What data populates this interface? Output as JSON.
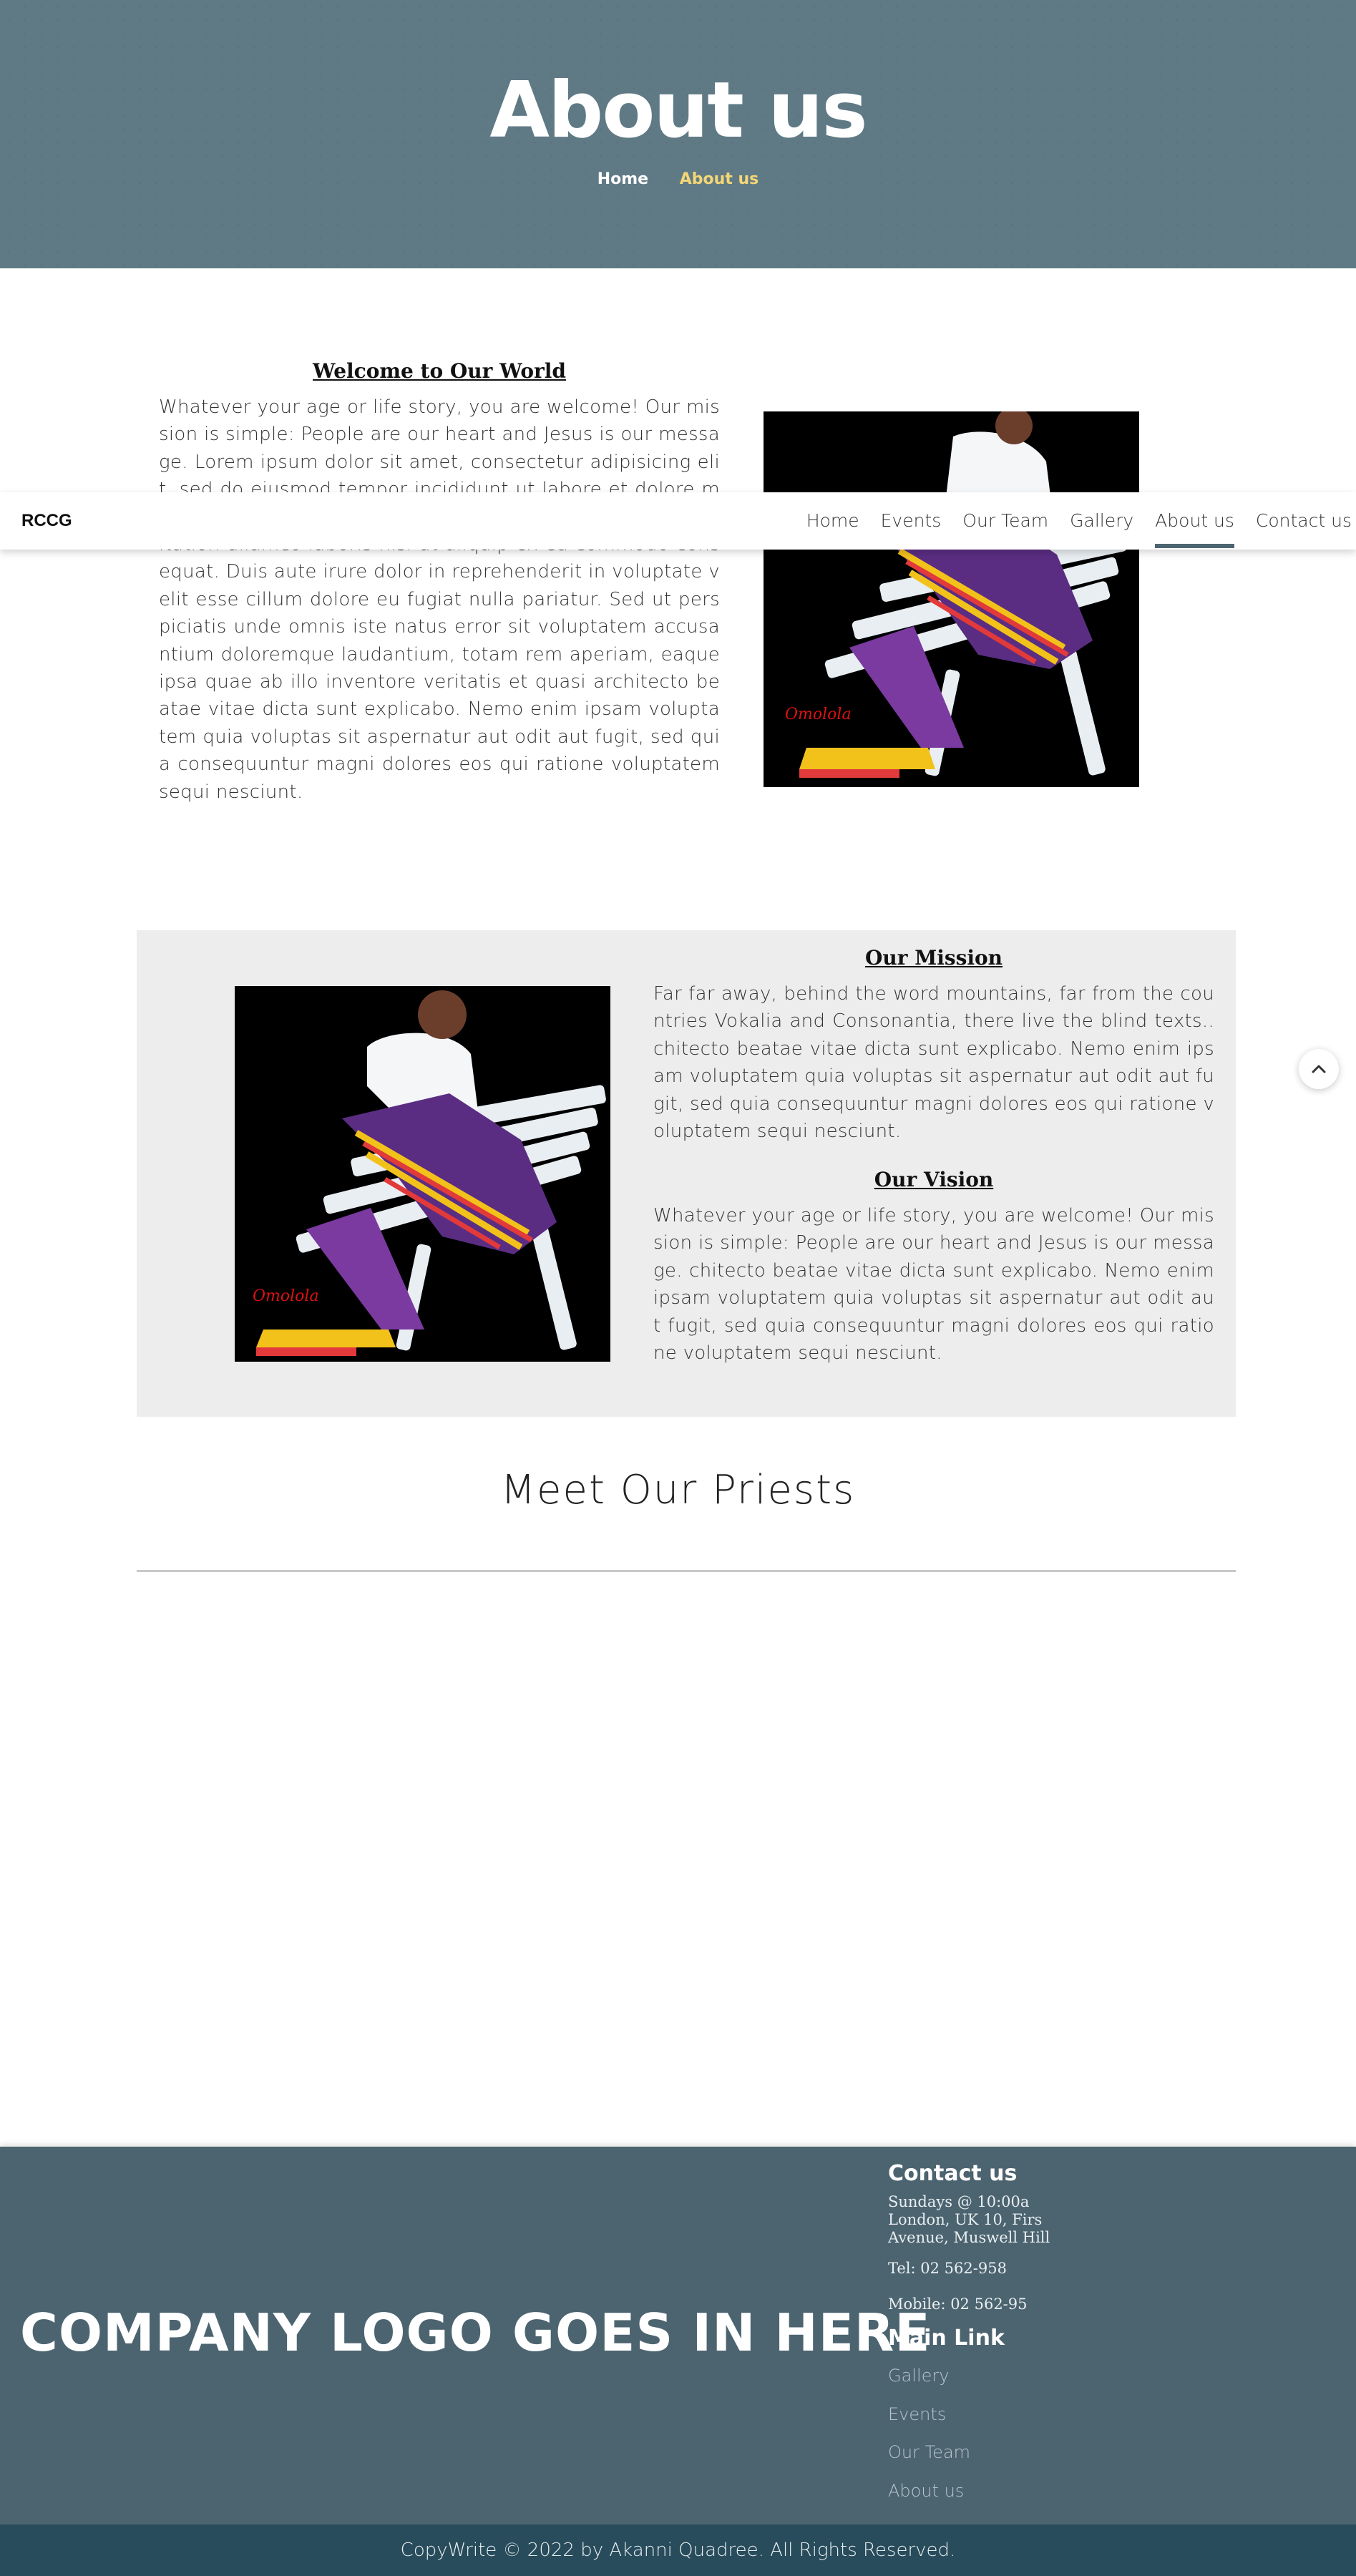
{
  "hero": {
    "title": "About us",
    "breadcrumb": {
      "home": "Home",
      "current": "About us"
    }
  },
  "navbar": {
    "brand": "RCCG",
    "items": [
      {
        "label": "Home",
        "active": false
      },
      {
        "label": "Events",
        "active": false
      },
      {
        "label": "Our Team",
        "active": false
      },
      {
        "label": "Gallery",
        "active": false
      },
      {
        "label": "About us",
        "active": true
      },
      {
        "label": "Contact us",
        "active": false
      }
    ]
  },
  "welcome": {
    "title": "Welcome to Our World",
    "text": "Whatever your age or life story, you are welcome! Our mission is simple: People are our heart and Jesus is our message. Lorem ipsum dolor sit amet, consectetur adipisicing elit, sed do eiusmod tempor incididunt ut labore et dolore magna aliqua. Ut enim ad minim veniam, quis nostrud exercitation ullamco laboris nisi ut aliquip ex ea commodo consequat. Duis aute irure dolor in reprehenderit in voluptate velit esse cillum dolore eu fugiat nulla pariatur. Sed ut perspiciatis unde omnis iste natus error sit voluptatem accusantium doloremque laudantium, totam rem aperiam, eaque ipsa quae ab illo inventore veritatis et quasi architecto beatae vitae dicta sunt explicabo. Nemo enim ipsam voluptatem quia voluptas sit aspernatur aut odit aut fugit, sed quia consequuntur magni dolores eos qui ratione voluptatem sequi nesciunt."
  },
  "mission": {
    "title": "Our Mission",
    "text": "Far far away, behind the word mountains, far from the countries Vokalia and Consonantia, there live the blind texts.. chitecto beatae vitae dicta sunt explicabo. Nemo enim ipsam voluptatem quia voluptas sit aspernatur aut odit aut fugit, sed quia consequuntur magni dolores eos qui ratione voluptatem sequi nesciunt."
  },
  "vision": {
    "title": "Our Vision",
    "text": "Whatever your age or life story, you are welcome! Our mission is simple: People are our heart and Jesus is our message. chitecto beatae vitae dicta sunt explicabo. Nemo enim ipsam voluptatem quia voluptas sit aspernatur aut odit aut fugit, sed quia consequuntur magni dolores eos qui ratione voluptatem sequi nesciunt."
  },
  "priests": {
    "title": "Meet Our Priests"
  },
  "footer": {
    "logo_text": "COMPANY LOGO GOES IN HERE",
    "contact": {
      "heading": "Contact us",
      "address": "Sundays @ 10:00a London, UK 10, Firs Avenue, Muswell Hill",
      "tel": "Tel: 02 562-958",
      "mobile": "Mobile: 02 562-95"
    },
    "links": {
      "heading": "Main Link",
      "items": [
        "Gallery",
        "Events",
        "Our Team",
        "About us"
      ]
    },
    "copyright": "CopyWrite © 2022 by Akanni Quadree. All Rights Reserved."
  },
  "colors": {
    "hero_bg": "#5f7a85",
    "breadcrumb_active": "#f5d676",
    "nav_active_underline": "#4d6571",
    "section_gray": "#ededed",
    "footer_bg": "#4c6470",
    "copyright_bg": "#284c5c"
  },
  "icons": {
    "scroll_top": "chevron-up-icon"
  }
}
